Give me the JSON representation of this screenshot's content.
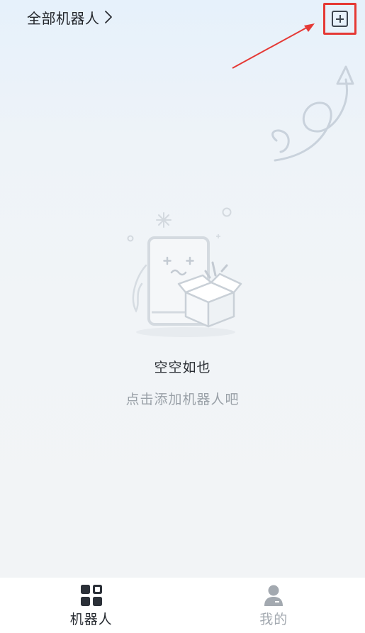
{
  "header": {
    "filter_label": "全部机器人",
    "filter_icon": "chevron-right-icon",
    "add_icon": "plus-square-icon",
    "highlight_color": "#e53935"
  },
  "empty_state": {
    "title": "空空如也",
    "hint": "点击添加机器人吧",
    "illustration": "empty-box-phone-icon"
  },
  "tabbar": {
    "tabs": [
      {
        "label": "机器人",
        "icon": "grid-apps-icon",
        "active": true
      },
      {
        "label": "我的",
        "icon": "person-icon",
        "active": false
      }
    ],
    "active_color": "#262a30",
    "inactive_color": "#a3a9b0"
  }
}
